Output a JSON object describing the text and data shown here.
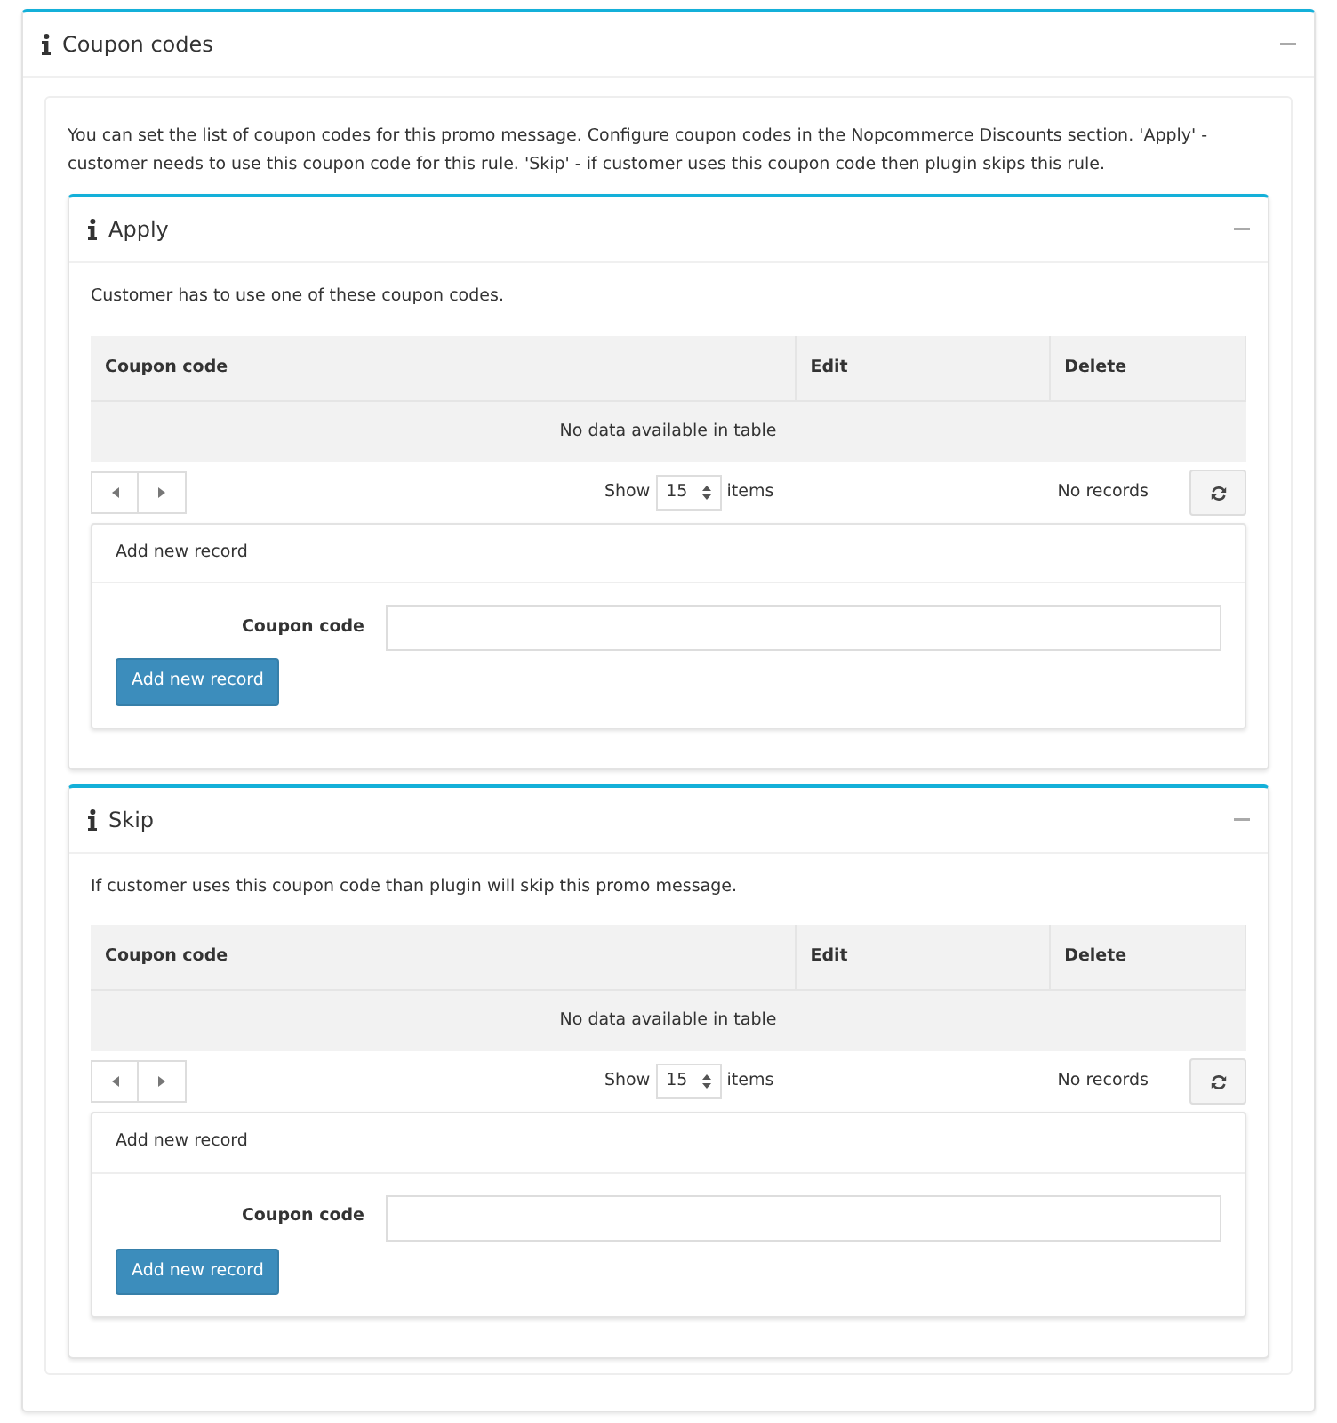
{
  "panel": {
    "title": "Coupon codes",
    "description": "You can set the list of coupon codes for this promo message. Configure coupon codes in the Nopcommerce Discounts section. 'Apply' - customer needs to use this coupon code for this rule. 'Skip' - if customer uses this coupon code then plugin skips this rule."
  },
  "sections": [
    {
      "title": "Apply",
      "description": "Customer has to use one of these coupon codes.",
      "table": {
        "columns": [
          "Coupon code",
          "Edit",
          "Delete"
        ],
        "empty_message": "No data available in table"
      },
      "pager": {
        "show_label": "Show",
        "page_size": "15",
        "items_label": "items",
        "records": "No records"
      },
      "add_form": {
        "title": "Add new record",
        "field_label": "Coupon code",
        "button": "Add new record"
      }
    },
    {
      "title": "Skip",
      "description": "If customer uses this coupon code than plugin will skip this promo message.",
      "table": {
        "columns": [
          "Coupon code",
          "Edit",
          "Delete"
        ],
        "empty_message": "No data available in table"
      },
      "pager": {
        "show_label": "Show",
        "page_size": "15",
        "items_label": "items",
        "records": "No records"
      },
      "add_form": {
        "title": "Add new record",
        "field_label": "Coupon code",
        "button": "Add new record"
      }
    }
  ]
}
